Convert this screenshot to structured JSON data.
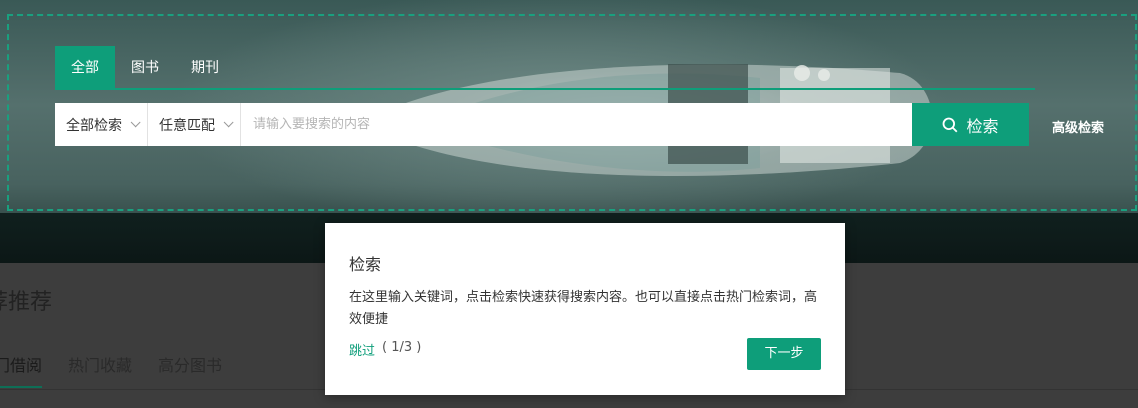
{
  "search_tabs": [
    "全部",
    "图书",
    "期刊"
  ],
  "search": {
    "scope_select": "全部检索",
    "match_select": "任意匹配",
    "placeholder": "请输入要搜索的内容",
    "button_label": "检索",
    "advanced_label": "高级检索"
  },
  "recommend": {
    "title": "荐推荐",
    "tabs": [
      "门借阅",
      "热门收藏",
      "高分图书"
    ]
  },
  "guide": {
    "title": "检索",
    "body": "在这里输入关键词，点击检索快速获得搜索内容。也可以直接点击热门检索词，高效便捷",
    "skip_label": "跳过",
    "progress": "( 1/3 )",
    "next_label": "下一步"
  },
  "colors": {
    "accent": "#0e9e7a"
  }
}
